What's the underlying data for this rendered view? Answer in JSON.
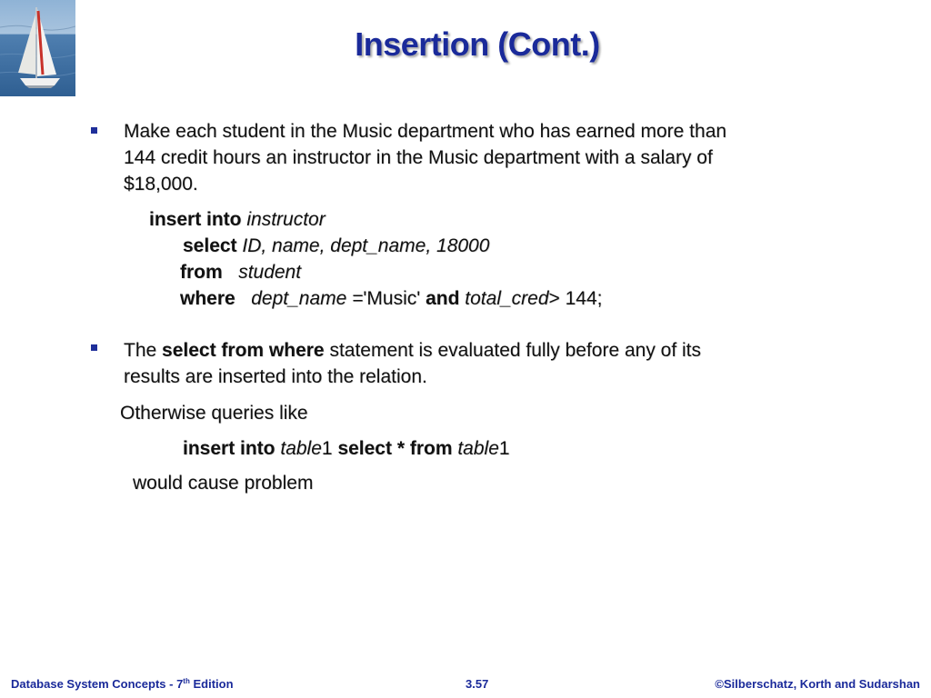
{
  "slide": {
    "title": "Insertion (Cont.)",
    "bullet1": {
      "lines": [
        "Make each student in the Music department who has earned more than",
        "144 credit hours an instructor in the Music department with a salary of",
        "$18,000."
      ]
    },
    "code1": {
      "line1_kw": "insert into",
      "line1_rel": "instructor",
      "line2_kw": "select",
      "line2_attrs": "ID, name, dept_name, 18000",
      "line3_kw": "from",
      "line3_rel": "student",
      "line4_kw": "where",
      "line4_attr": "dept_name =",
      "line4_val": "'Music'",
      "line4_and": "and",
      "line4_attr2": "total_cred",
      "line4_rest": "> 144;"
    },
    "bullet2": {
      "pre": "The",
      "bold": "select from where",
      "post": "statement is evaluated fully before any of its",
      "line2": "results are inserted into the relation."
    },
    "otherwise": "Otherwise queries like",
    "code2": {
      "kw1": "insert into",
      "tbl1": "table",
      "num1": "1",
      "kw2": "select * from",
      "tbl2": "table",
      "num2": "1"
    },
    "consequence": "would cause problem"
  },
  "footer": {
    "left_pre": "Database System Concepts - 7",
    "left_sup": "th",
    "left_post": " Edition",
    "center": "3.57",
    "right": "©Silberschatz, Korth and Sudarshan"
  },
  "colors": {
    "title": "#1a2a9a",
    "bullet": "#1f2f9a",
    "footer": "#1a2a9a"
  },
  "icons": {
    "logo": "sailboat-logo"
  }
}
